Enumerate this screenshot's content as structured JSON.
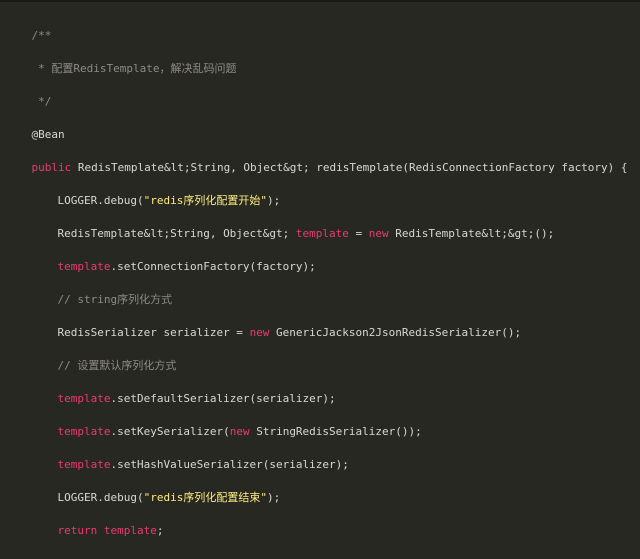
{
  "code": {
    "comment_open": "/**",
    "comment_body": " * 配置RedisTemplate，解决乱码问题",
    "comment_close": " */",
    "annotation": "@Bean",
    "sig_keyword": "public",
    "sig_rest": " RedisTemplate&lt;String, Object&gt; redisTemplate(RedisConnectionFactory factory) {",
    "l1_a": "LOGGER.debug(",
    "l1_str": "\"redis序列化配置开始\"",
    "l1_b": ");",
    "l2_a": "RedisTemplate&lt;String, Object&gt; ",
    "l2_var": "template",
    "l2_b": " = ",
    "l2_new": "new",
    "l2_c": " RedisTemplate&lt;&gt;();",
    "l3_var": "template",
    "l3_a": ".setConnectionFactory(factory);",
    "l4_comment": "// string序列化方式",
    "l5_a": "RedisSerializer serializer = ",
    "l5_new": "new",
    "l5_b": " GenericJackson2JsonRedisSerializer();",
    "l6_comment": "// 设置默认序列化方式",
    "l7_var": "template",
    "l7_a": ".setDefaultSerializer(serializer);",
    "l8_var": "template",
    "l8_a": ".setKeySerializer(",
    "l8_new": "new",
    "l8_b": " StringRedisSerializer());",
    "l9_var": "template",
    "l9_a": ".setHashValueSerializer(serializer);",
    "l10_a": "LOGGER.debug(",
    "l10_str": "\"redis序列化配置结束\"",
    "l10_b": ");",
    "l11_return": "return",
    "l11_var": " template",
    "l11_a": ";",
    "close_brace": "}"
  },
  "colors": {
    "background": "#272822",
    "plain": "#d8d8d2",
    "comment": "#8d8c84",
    "keyword": "#ea3a72",
    "string": "#ffeb7f"
  }
}
